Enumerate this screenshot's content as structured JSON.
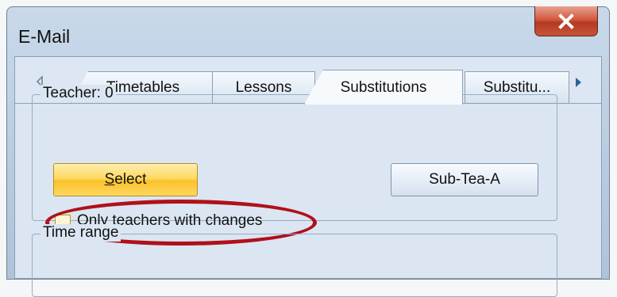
{
  "window": {
    "title": "E-Mail"
  },
  "tabs": [
    {
      "label": "Timetables"
    },
    {
      "label": "Lessons"
    },
    {
      "label": "Substitutions"
    },
    {
      "label": "Substitu..."
    }
  ],
  "teacher_group": {
    "label": "Teacher: 0",
    "select_button": {
      "accel": "S",
      "rest": "elect"
    },
    "sub_tea_button": "Sub-Tea-A",
    "only_changes_checkbox": {
      "label": "Only teachers with changes",
      "checked": false
    }
  },
  "time_group": {
    "label": "Time range"
  },
  "annotation": {
    "color": "#b0101a"
  }
}
